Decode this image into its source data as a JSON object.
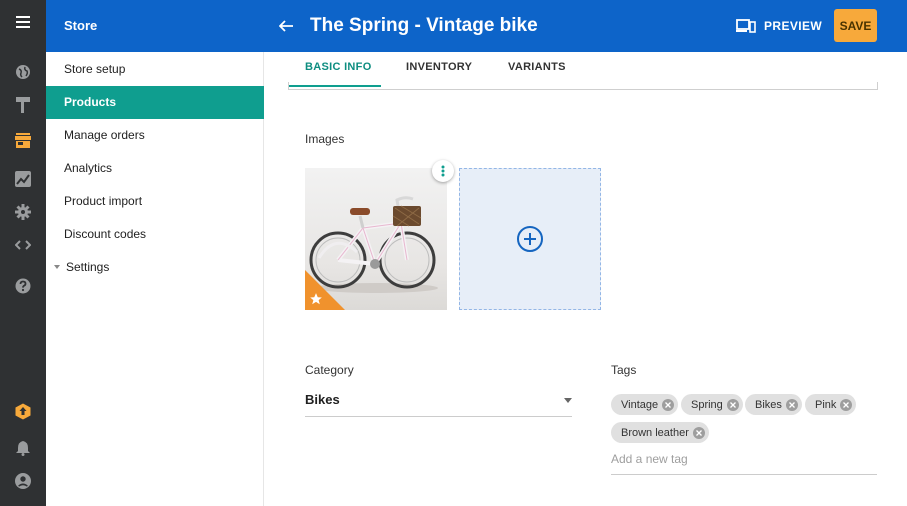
{
  "rail": {
    "icons": [
      "menu-icon",
      "globe-icon",
      "paint-roller-icon",
      "store-icon",
      "chart-icon",
      "gear-icon",
      "code-icon",
      "help-icon",
      "hex-up-icon",
      "bell-icon",
      "account-icon"
    ],
    "active_color": "#f7a93b"
  },
  "topbar": {
    "store_title": "Store",
    "page_title": "The Spring - Vintage bike",
    "preview_label": "PREVIEW",
    "save_label": "SAVE"
  },
  "sidebar": {
    "items": [
      {
        "label": "Store setup"
      },
      {
        "label": "Products",
        "active": true
      },
      {
        "label": "Manage orders"
      },
      {
        "label": "Analytics"
      },
      {
        "label": "Product import"
      },
      {
        "label": "Discount codes"
      },
      {
        "label": "Settings",
        "collapsible": true
      }
    ]
  },
  "main": {
    "tabs": [
      {
        "label": "BASIC INFO",
        "active": true
      },
      {
        "label": "INVENTORY"
      },
      {
        "label": "VARIANTS"
      }
    ],
    "images_label": "Images",
    "category": {
      "label": "Category",
      "value": "Bikes"
    },
    "tags": {
      "label": "Tags",
      "items": [
        "Vintage",
        "Spring",
        "Bikes",
        "Pink",
        "Brown leather"
      ],
      "placeholder": "Add a new tag"
    }
  },
  "colors": {
    "topbar": "#0d64c9",
    "active_nav": "#0f9e8f",
    "save_button": "#f7a93b",
    "rail": "#2f3133"
  }
}
